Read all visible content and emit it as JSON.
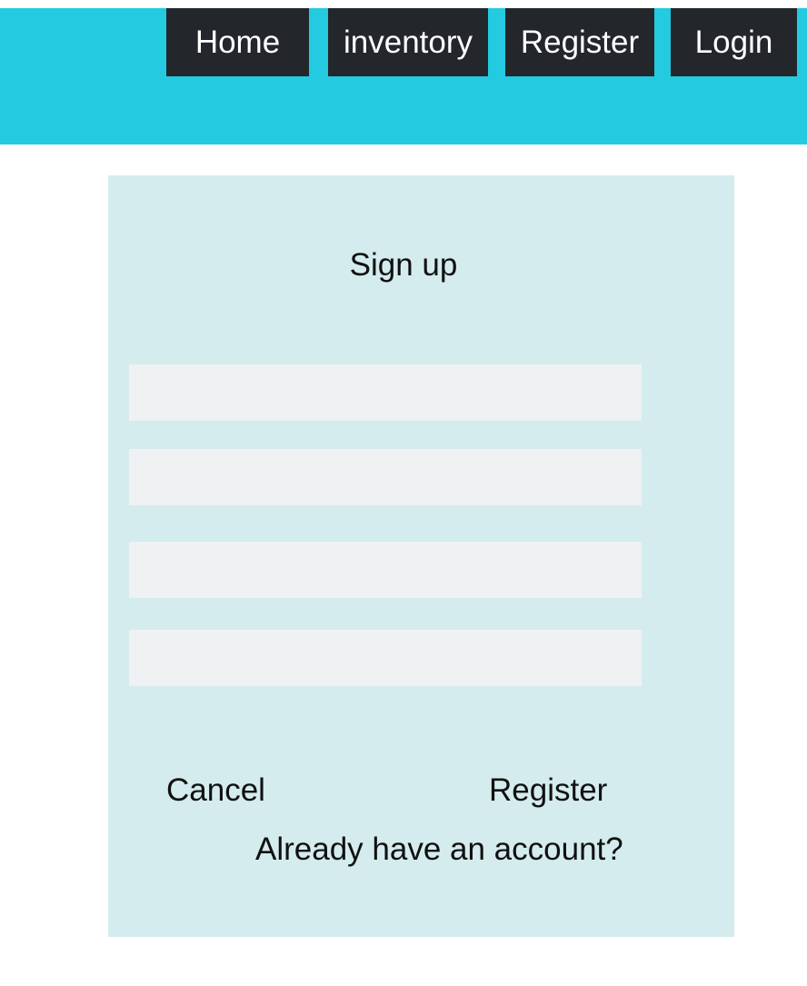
{
  "nav": {
    "home_label": "Home",
    "inventory_label": "inventory",
    "register_label": "Register",
    "login_label": "Login"
  },
  "form": {
    "title": "Sign up",
    "fields": [
      {
        "value": "",
        "placeholder": ""
      },
      {
        "value": "",
        "placeholder": ""
      },
      {
        "value": "",
        "placeholder": ""
      },
      {
        "value": "",
        "placeholder": ""
      }
    ],
    "cancel_label": "Cancel",
    "register_label": "Register",
    "login_prompt": "Already have an account?"
  },
  "colors": {
    "header_bg": "#24cae0",
    "nav_button_bg": "#23262b",
    "card_bg": "#d4ecee",
    "field_bg": "#f0f1f3"
  }
}
